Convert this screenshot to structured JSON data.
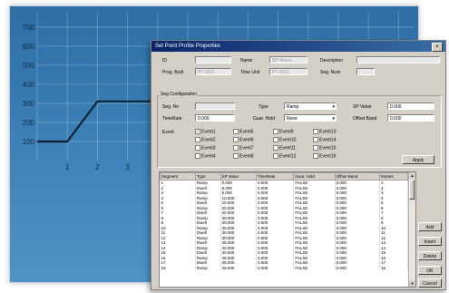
{
  "chart": {
    "chart_data": {
      "type": "line",
      "yticks": [
        100,
        200,
        300,
        400,
        500,
        600,
        700
      ],
      "xticks": [
        "1",
        "2",
        "3",
        "4"
      ],
      "ylim": [
        0,
        780
      ],
      "xlim": [
        0,
        12.5
      ],
      "grid": true,
      "series": [
        {
          "x": [
            0,
            1,
            2,
            3,
            4,
            5,
            6
          ],
          "y": [
            100,
            100,
            310,
            310,
            310,
            410,
            410
          ],
          "color": "#0d2238"
        }
      ]
    }
  },
  "dialog": {
    "title": "Set Point Profile Properties",
    "close": "×",
    "id_label": "ID",
    "id_value": "",
    "name_label": "Name",
    "name_value": "SP-Name",
    "desc_label": "Description",
    "desc_value": "",
    "first_name_label": "Prog. Built",
    "first_name_value": "PT-0001",
    "time_unit_label": "Time Unit",
    "time_unit_value": "PT-0001",
    "seg_count_label": "Seg. Num",
    "seg_count_value": "",
    "seg_group": "Seg Configuration",
    "seg_no_label": "Seg. No",
    "seg_no_value": "",
    "type_label": "Type",
    "type_value": "Ramp",
    "sp_value_label": "SP Value",
    "sp_value": "0.000",
    "time_rate_label": "TimeRate",
    "time_rate_value": "0.000",
    "guar_soak_label": "Guar. Hold",
    "guar_soak_value": "None",
    "offset_label": "Offset Band",
    "offset_value": "0.000",
    "events_label": "Event",
    "events": [
      [
        "Event1",
        "Event5",
        "Event9",
        "Event13"
      ],
      [
        "Event2",
        "Event6",
        "Event10",
        "Event14"
      ],
      [
        "Event3",
        "Event7",
        "Event11",
        "Event15"
      ],
      [
        "Event4",
        "Event8",
        "Event12",
        "Event16"
      ]
    ],
    "apply": "Apply",
    "buttons": [
      "Add",
      "Insert",
      "Delete",
      "OK",
      "Cancel"
    ],
    "table": {
      "columns": [
        "Segment",
        "Type",
        "SP Value",
        "TimeRate",
        "Guar. Hold",
        "Offset Band",
        "Events"
      ],
      "rows": [
        [
          "1",
          "Ramp",
          "0.000",
          "0.000",
          "FALSE",
          "0.000",
          "1"
        ],
        [
          "2",
          "Dwell",
          "5.000",
          "0.000",
          "FALSE",
          "0.000",
          "2"
        ],
        [
          "3",
          "Ramp",
          "5.000",
          "0.000",
          "FALSE",
          "0.000",
          "3"
        ],
        [
          "4",
          "Ramp",
          "10.000",
          "0.000",
          "FALSE",
          "0.000",
          "4"
        ],
        [
          "5",
          "Dwell",
          "10.000",
          "0.000",
          "FALSE",
          "0.000",
          "5"
        ],
        [
          "6",
          "Ramp",
          "20.000",
          "0.000",
          "FALSE",
          "0.000",
          "6"
        ],
        [
          "7",
          "Dwell",
          "20.000",
          "0.000",
          "FALSE",
          "0.000",
          "7"
        ],
        [
          "8",
          "Ramp",
          "30.000",
          "0.000",
          "FALSE",
          "0.000",
          "8"
        ],
        [
          "9",
          "Dwell",
          "30.000",
          "0.000",
          "FALSE",
          "0.000",
          "9"
        ],
        [
          "10",
          "Ramp",
          "30.000",
          "0.000",
          "FALSE",
          "0.000",
          "10"
        ],
        [
          "11",
          "Dwell",
          "30.000",
          "0.000",
          "FALSE",
          "0.000",
          "11"
        ],
        [
          "12",
          "Ramp",
          "30.000",
          "0.000",
          "FALSE",
          "0.000",
          "12"
        ],
        [
          "13",
          "Dwell",
          "35.000",
          "0.000",
          "FALSE",
          "0.000",
          "13"
        ],
        [
          "14",
          "Ramp",
          "40.000",
          "0.000",
          "FALSE",
          "0.000",
          "14"
        ],
        [
          "15",
          "Dwell",
          "40.000",
          "0.000",
          "FALSE",
          "0.000",
          "15"
        ],
        [
          "16",
          "Ramp",
          "45.000",
          "0.000",
          "FALSE",
          "0.000",
          "16"
        ],
        [
          "17",
          "Dwell",
          "45.000",
          "0.000",
          "FALSE",
          "0.000",
          "17"
        ],
        [
          "18",
          "Ramp",
          "45.000",
          "0.000",
          "FALSE",
          "0.000",
          "18"
        ]
      ]
    }
  }
}
